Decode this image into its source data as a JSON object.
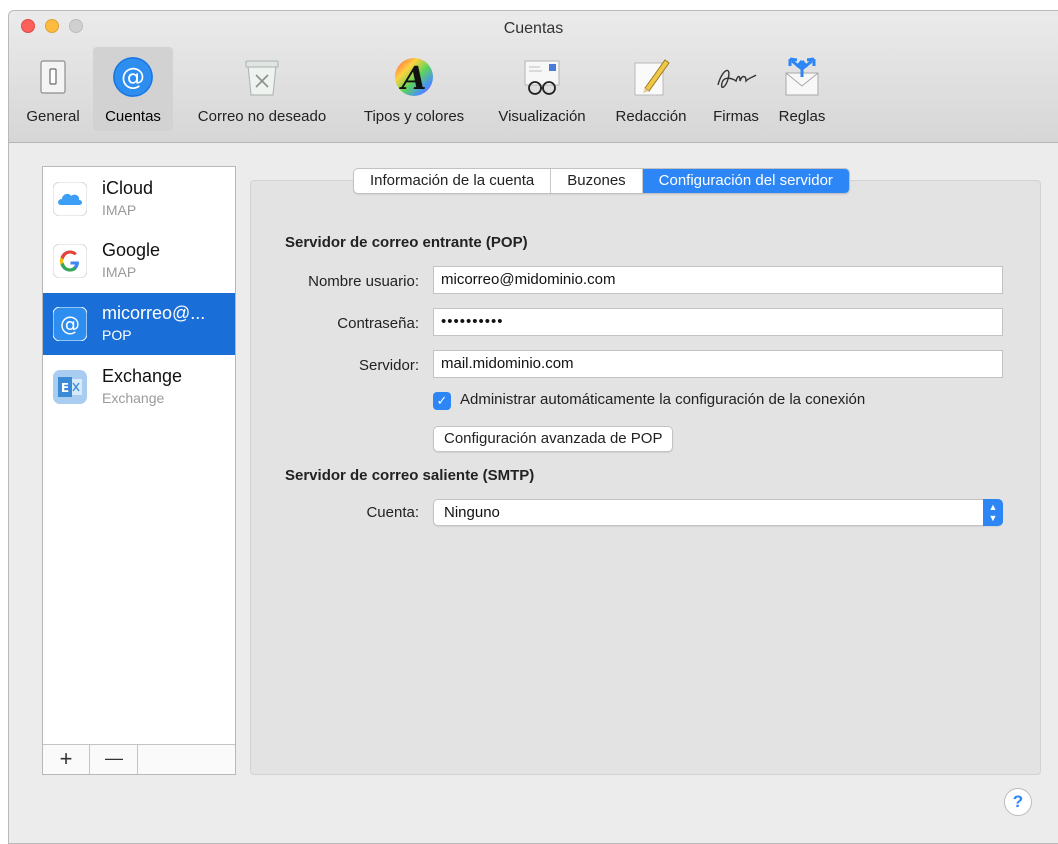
{
  "window": {
    "title": "Cuentas"
  },
  "toolbar": {
    "items": [
      {
        "label": "General",
        "icon": "switch-icon"
      },
      {
        "label": "Cuentas",
        "icon": "at-icon",
        "active": true
      },
      {
        "label": "Correo no deseado",
        "icon": "junk-bin-icon"
      },
      {
        "label": "Tipos y colores",
        "icon": "font-colors-icon"
      },
      {
        "label": "Visualización",
        "icon": "glasses-icon"
      },
      {
        "label": "Redacción",
        "icon": "pencil-icon"
      },
      {
        "label": "Firmas",
        "icon": "signature-icon"
      },
      {
        "label": "Reglas",
        "icon": "rules-icon"
      }
    ]
  },
  "accounts": [
    {
      "name": "iCloud",
      "type": "IMAP",
      "icon": "icloud-icon"
    },
    {
      "name": "Google",
      "type": "IMAP",
      "icon": "google-icon"
    },
    {
      "name": "micorreo@...",
      "type": "POP",
      "icon": "at-icon",
      "selected": true
    },
    {
      "name": "Exchange",
      "type": "Exchange",
      "icon": "exchange-icon"
    }
  ],
  "sidebar_buttons": {
    "add": "+",
    "remove": "—"
  },
  "tabs": [
    {
      "label": "Información de la cuenta"
    },
    {
      "label": "Buzones"
    },
    {
      "label": "Configuración del servidor",
      "active": true
    }
  ],
  "incoming": {
    "heading": "Servidor de correo entrante (POP)",
    "username_label": "Nombre usuario:",
    "username": "micorreo@midominio.com",
    "password_label": "Contraseña:",
    "password": "••••••••••",
    "server_label": "Servidor:",
    "server": "mail.midominio.com",
    "auto_manage_label": "Administrar automáticamente la configuración de la conexión",
    "auto_manage_checked": true,
    "advanced_button": "Configuración avanzada de POP"
  },
  "outgoing": {
    "heading": "Servidor de correo saliente (SMTP)",
    "account_label": "Cuenta:",
    "account_value": "Ninguno"
  },
  "help": {
    "label": "?"
  },
  "colors": {
    "accent": "#2d86f5",
    "selection": "#1a6ed8"
  }
}
